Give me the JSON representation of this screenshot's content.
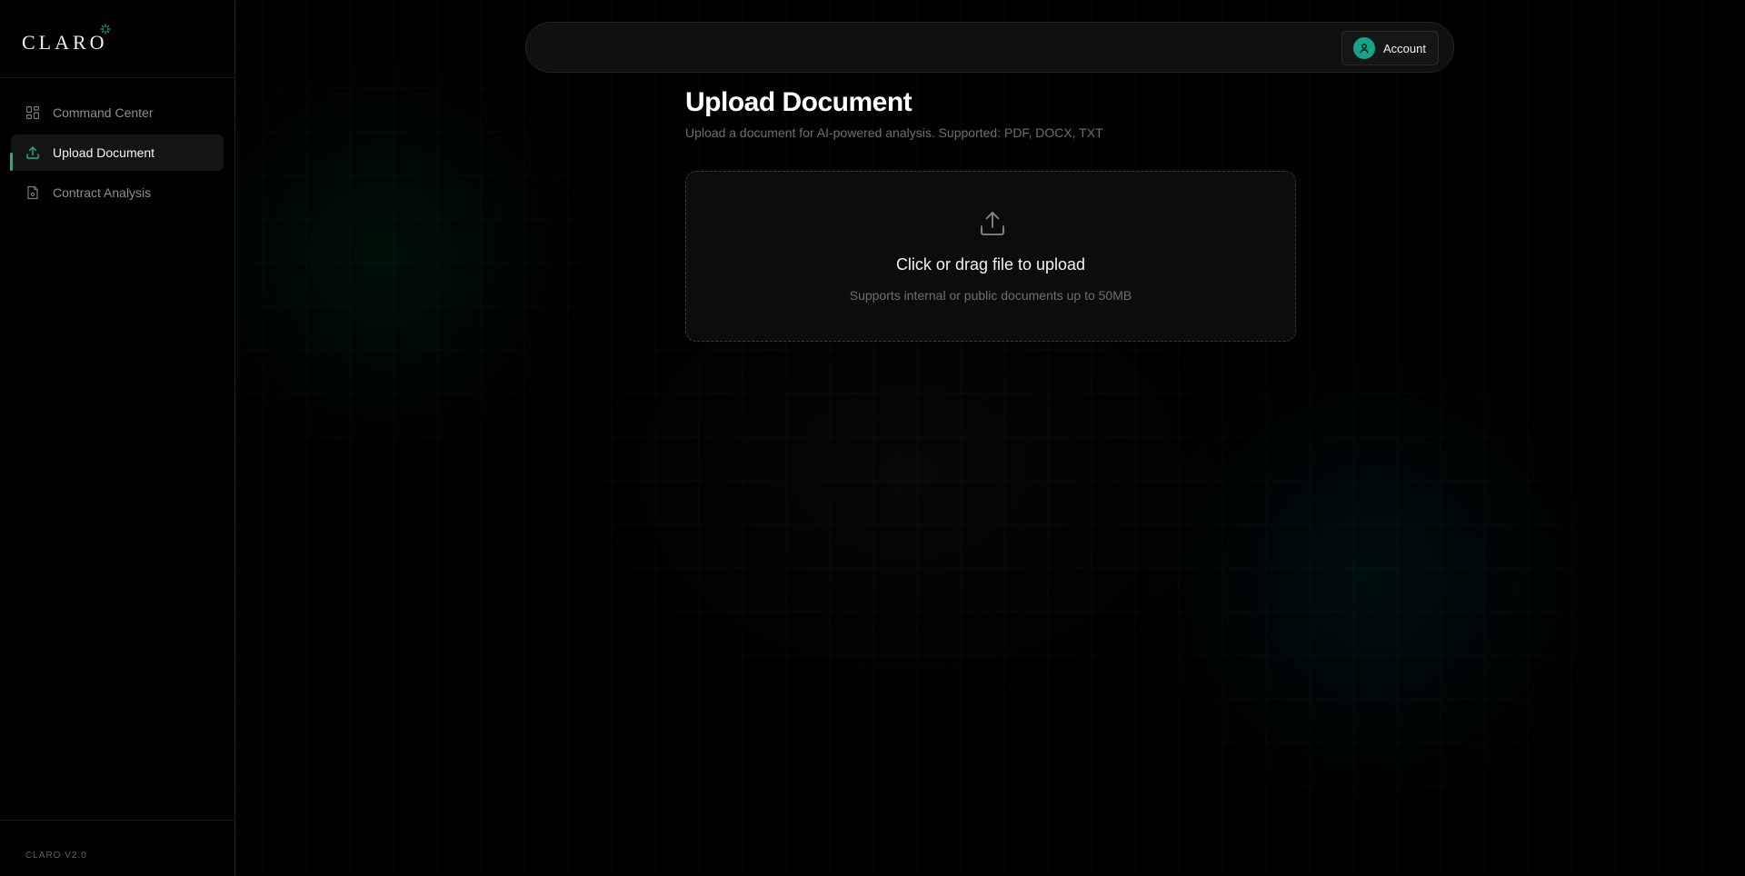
{
  "brand": {
    "logo_text": "CLARO",
    "accent": "#10b981",
    "avatar_color": "#14a38b"
  },
  "sidebar": {
    "items": [
      {
        "label": "Command Center",
        "icon": "grid-icon",
        "active": false
      },
      {
        "label": "Upload Document",
        "icon": "upload-icon",
        "active": true
      },
      {
        "label": "Contract Analysis",
        "icon": "document-icon",
        "active": false
      }
    ],
    "version": "CLARO V2.0"
  },
  "header": {
    "account_label": "Account",
    "account_icon": "user-icon"
  },
  "main": {
    "title": "Upload Document",
    "subtitle": "Upload a document for AI-powered analysis. Supported: PDF, DOCX, TXT",
    "dropzone": {
      "icon": "upload-icon",
      "title": "Click or drag file to upload",
      "subtitle": "Supports internal or public documents up to 50MB"
    }
  }
}
